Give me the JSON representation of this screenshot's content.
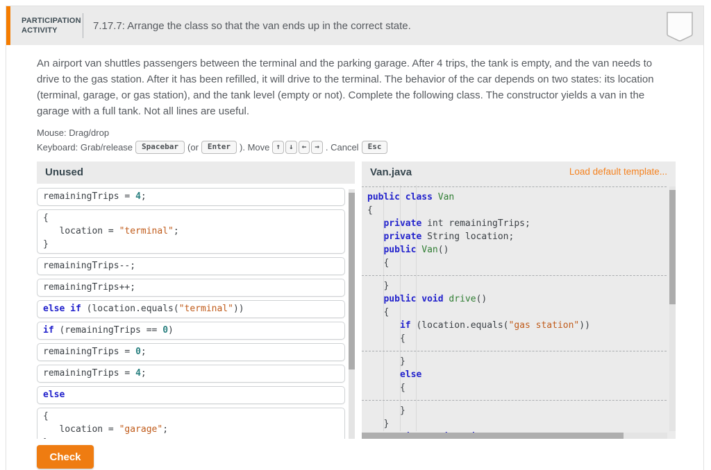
{
  "header": {
    "badge_line1": "PARTICIPATION",
    "badge_line2": "ACTIVITY",
    "title": "7.17.7: Arrange the class so that the van ends up in the correct state."
  },
  "description": "An airport van shuttles passengers between the terminal and the parking garage. After 4 trips, the tank is empty, and the van needs to drive to the gas station. After it has been refilled, it will drive to the terminal. The behavior of the car depends on two states: its location (terminal, garage, or gas station), and the tank level (empty or not). Complete the following class. The constructor yields a van in the garage with a full tank. Not all lines are useful.",
  "instructions": {
    "mouse": "Mouse: Drag/drop",
    "keyboard_prefix": "Keyboard: Grab/release",
    "key_spacebar": "Spacebar",
    "or_open": "(or",
    "or_close": "). Move",
    "key_enter": "Enter",
    "keys_arrows": [
      "↑",
      "↓",
      "←",
      "→"
    ],
    "cancel_label": ". Cancel",
    "key_esc": "Esc"
  },
  "colors": {
    "accent_orange": "#f57c00",
    "link_orange": "#f5821f",
    "button_orange": "#ef7c11",
    "keyword_blue": "#2222cc",
    "string_orange": "#c05b1a",
    "number_teal": "#2a8080",
    "name_green": "#2f7d32"
  },
  "unused_panel": {
    "title": "Unused",
    "blocks": [
      {
        "lines": [
          [
            [
              "p",
              "remainingTrips = "
            ],
            [
              "n",
              "4"
            ],
            [
              "p",
              ";"
            ]
          ]
        ]
      },
      {
        "lines": [
          [
            [
              "p",
              "{"
            ]
          ],
          [
            [
              "p",
              "   location = "
            ],
            [
              "s",
              "\"terminal\""
            ],
            [
              "p",
              ";"
            ]
          ],
          [
            [
              "p",
              "}"
            ]
          ]
        ]
      },
      {
        "lines": [
          [
            [
              "p",
              "remainingTrips--;"
            ]
          ]
        ]
      },
      {
        "lines": [
          [
            [
              "p",
              "remainingTrips++;"
            ]
          ]
        ]
      },
      {
        "lines": [
          [
            [
              "k",
              "else if"
            ],
            [
              "p",
              " (location.equals("
            ],
            [
              "s",
              "\"terminal\""
            ],
            [
              "p",
              "))"
            ]
          ]
        ]
      },
      {
        "lines": [
          [
            [
              "k",
              "if"
            ],
            [
              "p",
              " (remainingTrips == "
            ],
            [
              "n",
              "0"
            ],
            [
              "p",
              ")"
            ]
          ]
        ]
      },
      {
        "lines": [
          [
            [
              "p",
              "remainingTrips = "
            ],
            [
              "n",
              "0"
            ],
            [
              "p",
              ";"
            ]
          ]
        ]
      },
      {
        "lines": [
          [
            [
              "p",
              "remainingTrips = "
            ],
            [
              "n",
              "4"
            ],
            [
              "p",
              ";"
            ]
          ]
        ]
      },
      {
        "lines": [
          [
            [
              "k",
              "else"
            ]
          ]
        ]
      },
      {
        "lines": [
          [
            [
              "p",
              "{"
            ]
          ],
          [
            [
              "p",
              "   location = "
            ],
            [
              "s",
              "\"garage\""
            ],
            [
              "p",
              ";"
            ]
          ],
          [
            [
              "p",
              "}"
            ]
          ]
        ]
      }
    ]
  },
  "target_panel": {
    "title": "Van.java",
    "link": "Load default template...",
    "segments": [
      {
        "lines": [
          [
            [
              "k",
              "public"
            ],
            [
              "p",
              " "
            ],
            [
              "k",
              "class"
            ],
            [
              "p",
              " "
            ],
            [
              "c",
              "Van"
            ]
          ],
          [
            [
              "p",
              "{"
            ]
          ],
          [
            [
              "p",
              "   "
            ],
            [
              "k",
              "private"
            ],
            [
              "p",
              " int remainingTrips;"
            ]
          ],
          [
            [
              "p",
              "   "
            ],
            [
              "k",
              "private"
            ],
            [
              "p",
              " String location;"
            ]
          ],
          [
            [
              "p",
              "   "
            ],
            [
              "k",
              "public"
            ],
            [
              "p",
              " "
            ],
            [
              "c",
              "Van"
            ],
            [
              "p",
              "()"
            ]
          ],
          [
            [
              "p",
              "   {"
            ]
          ]
        ]
      },
      {
        "lines": [
          [
            [
              "p",
              "   }"
            ]
          ],
          [
            [
              "p",
              "   "
            ],
            [
              "k",
              "public"
            ],
            [
              "p",
              " "
            ],
            [
              "k",
              "void"
            ],
            [
              "p",
              " "
            ],
            [
              "c",
              "drive"
            ],
            [
              "p",
              "()"
            ]
          ],
          [
            [
              "p",
              "   {"
            ]
          ],
          [
            [
              "p",
              "      "
            ],
            [
              "k",
              "if"
            ],
            [
              "p",
              " (location.equals("
            ],
            [
              "s",
              "\"gas station\""
            ],
            [
              "p",
              "))"
            ]
          ],
          [
            [
              "p",
              "      {"
            ]
          ]
        ]
      },
      {
        "lines": [
          [
            [
              "p",
              "      }"
            ]
          ],
          [
            [
              "p",
              "      "
            ],
            [
              "k",
              "else"
            ]
          ],
          [
            [
              "p",
              "      {"
            ]
          ]
        ]
      },
      {
        "lines": [
          [
            [
              "p",
              "      }"
            ]
          ],
          [
            [
              "p",
              "   }"
            ]
          ],
          [
            [
              "p",
              "   "
            ],
            [
              "k",
              "public"
            ],
            [
              "p",
              " "
            ],
            [
              "k",
              "static"
            ],
            [
              "p",
              " "
            ],
            [
              "k",
              "void"
            ],
            [
              "p",
              " "
            ],
            [
              "c",
              "main"
            ],
            [
              "p",
              "(String [] arg)"
            ]
          ]
        ]
      }
    ]
  },
  "check_button": "Check"
}
